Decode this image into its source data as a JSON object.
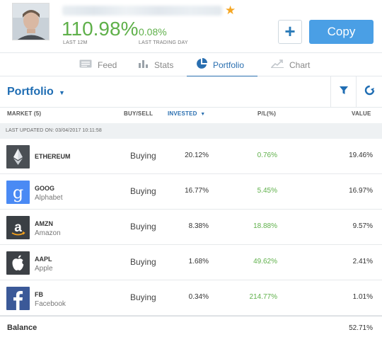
{
  "header": {
    "gain_value": "110.98%",
    "gain_label": "LAST 12M",
    "day_value": "0.08%",
    "day_label": "LAST TRADING DAY",
    "plus_label": "+",
    "copy_label": "Copy"
  },
  "tabs": [
    {
      "label": "Feed",
      "icon": "feed-icon"
    },
    {
      "label": "Stats",
      "icon": "stats-icon"
    },
    {
      "label": "Portfolio",
      "icon": "pie-chart-icon",
      "active": true
    },
    {
      "label": "Chart",
      "icon": "chart-icon"
    }
  ],
  "portfolio": {
    "title": "Portfolio",
    "columns": {
      "market": "MARKET (5)",
      "buysell": "BUY/SELL",
      "invested": "INVESTED",
      "pl": "P/L(%)",
      "value": "VALUE"
    },
    "last_updated": "LAST UPDATED ON: 03/04/2017 10:11:58",
    "rows": [
      {
        "symbol": "ETHEREUM",
        "company": "",
        "action": "Buying",
        "invested": "20.12%",
        "pl": "0.76%",
        "value": "19.46%",
        "logo": "ethereum-logo"
      },
      {
        "symbol": "GOOG",
        "company": "Alphabet",
        "action": "Buying",
        "invested": "16.77%",
        "pl": "5.45%",
        "value": "16.97%",
        "logo": "google-logo"
      },
      {
        "symbol": "AMZN",
        "company": "Amazon",
        "action": "Buying",
        "invested": "8.38%",
        "pl": "18.88%",
        "value": "9.57%",
        "logo": "amazon-logo"
      },
      {
        "symbol": "AAPL",
        "company": "Apple",
        "action": "Buying",
        "invested": "1.68%",
        "pl": "49.62%",
        "value": "2.41%",
        "logo": "apple-logo"
      },
      {
        "symbol": "FB",
        "company": "Facebook",
        "action": "Buying",
        "invested": "0.34%",
        "pl": "214.77%",
        "value": "1.01%",
        "logo": "facebook-logo"
      }
    ],
    "balance_label": "Balance",
    "balance_value": "52.71%"
  },
  "colors": {
    "accent": "#2a6fb0",
    "positive": "#5fb04a",
    "copy_button": "#4a9fe5",
    "star": "#f5a623"
  }
}
